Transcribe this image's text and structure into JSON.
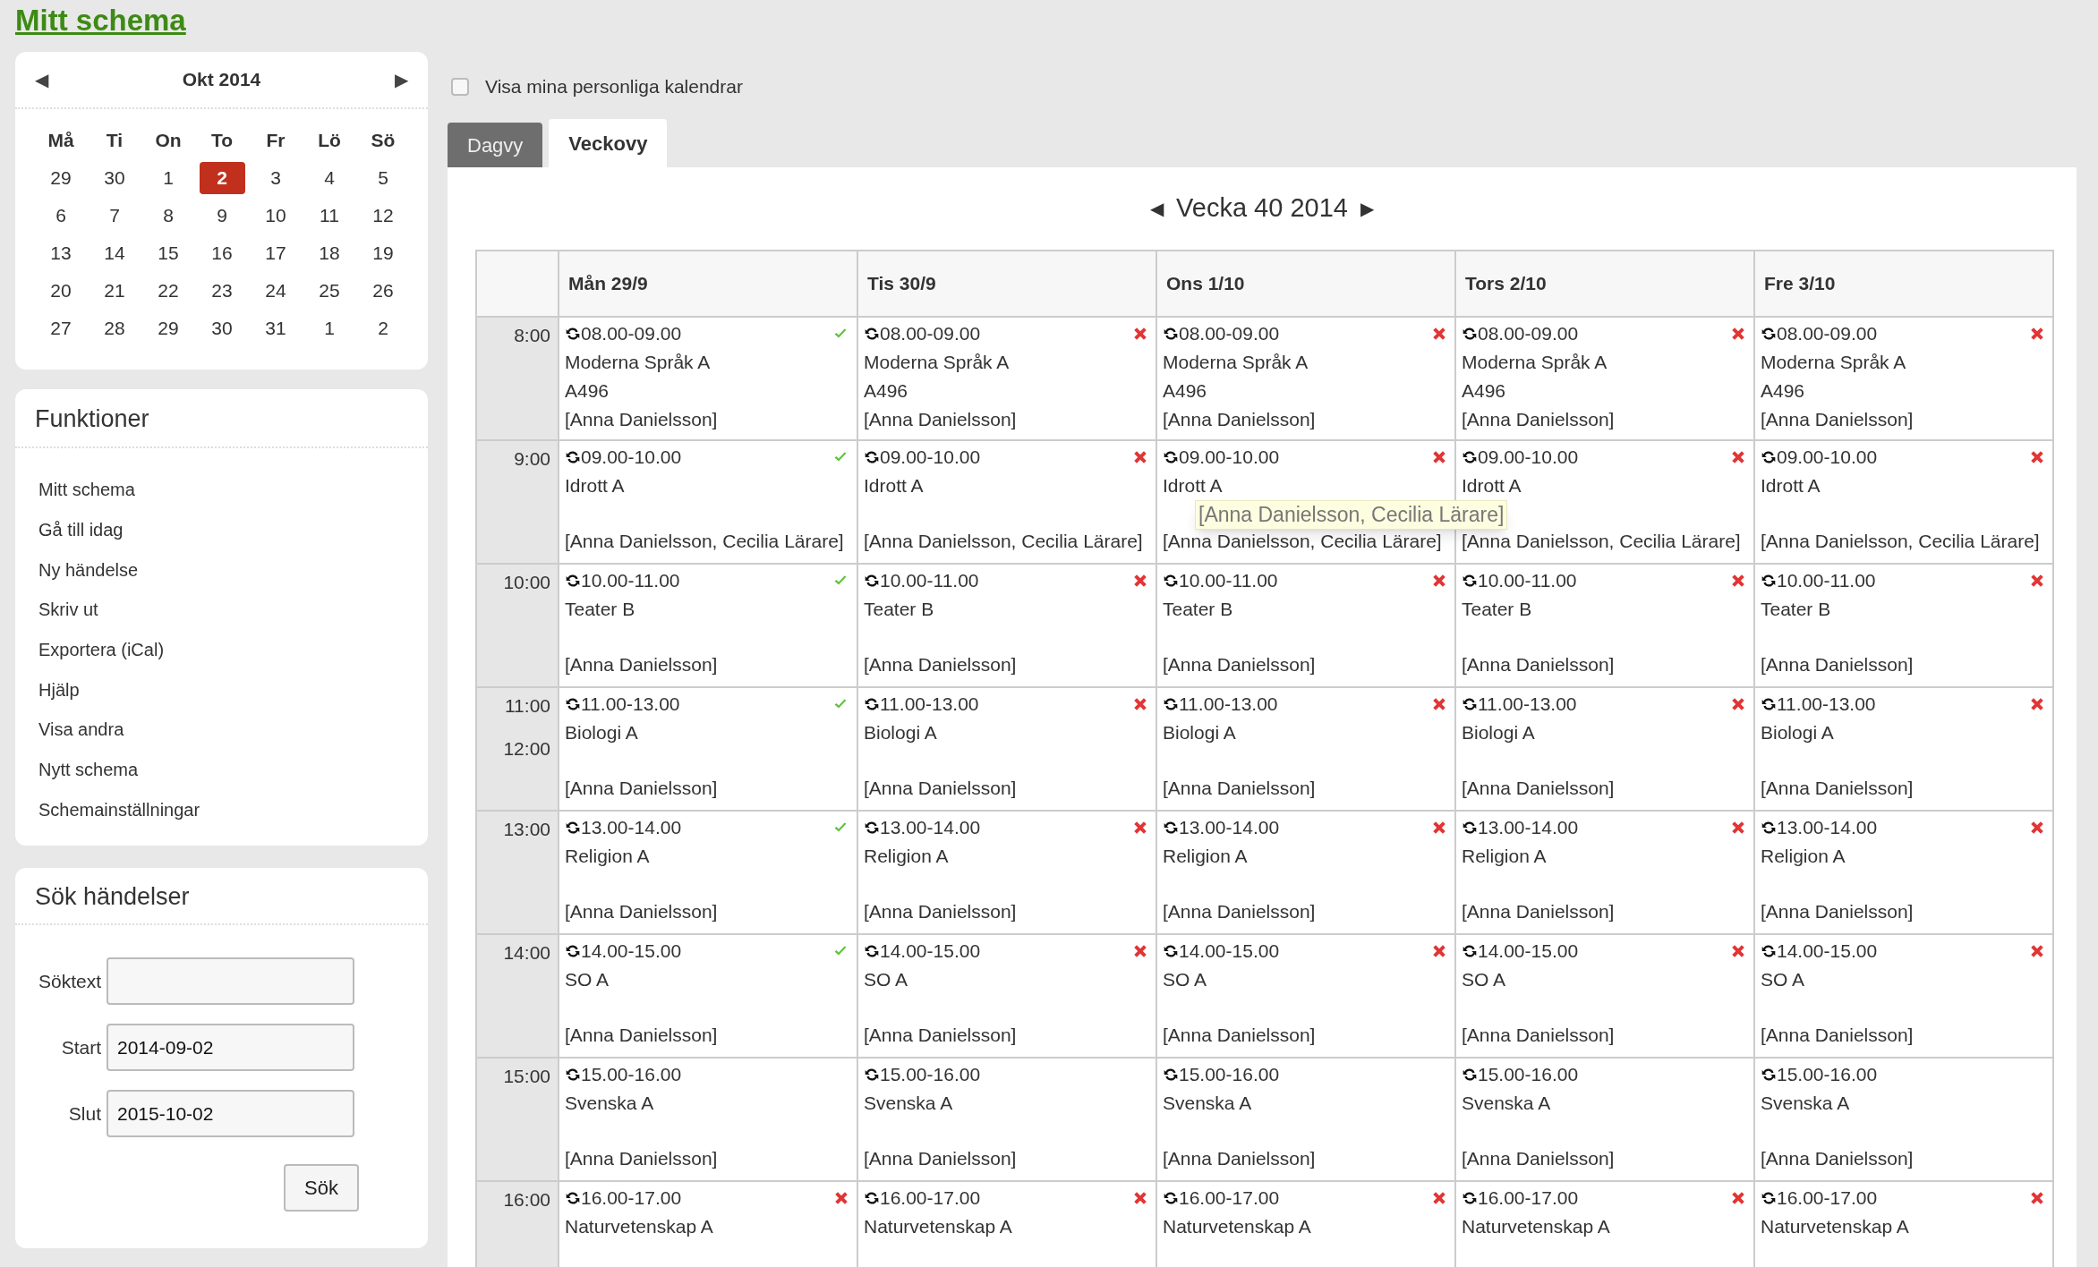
{
  "title": "Mitt schema",
  "mini_calendar": {
    "month": "Okt 2014",
    "prev": "◀",
    "next": "▶",
    "weekdays": [
      "Må",
      "Ti",
      "On",
      "To",
      "Fr",
      "Lö",
      "Sö"
    ],
    "weeks": [
      [
        {
          "day": "29",
          "selected": false
        },
        {
          "day": "30",
          "selected": false
        },
        {
          "day": "1",
          "selected": false
        },
        {
          "day": "2",
          "selected": true
        },
        {
          "day": "3",
          "selected": false
        },
        {
          "day": "4",
          "selected": false
        },
        {
          "day": "5",
          "selected": false
        }
      ],
      [
        {
          "day": "6",
          "selected": false
        },
        {
          "day": "7",
          "selected": false
        },
        {
          "day": "8",
          "selected": false
        },
        {
          "day": "9",
          "selected": false
        },
        {
          "day": "10",
          "selected": false
        },
        {
          "day": "11",
          "selected": false
        },
        {
          "day": "12",
          "selected": false
        }
      ],
      [
        {
          "day": "13",
          "selected": false
        },
        {
          "day": "14",
          "selected": false
        },
        {
          "day": "15",
          "selected": false
        },
        {
          "day": "16",
          "selected": false
        },
        {
          "day": "17",
          "selected": false
        },
        {
          "day": "18",
          "selected": false
        },
        {
          "day": "19",
          "selected": false
        }
      ],
      [
        {
          "day": "20",
          "selected": false
        },
        {
          "day": "21",
          "selected": false
        },
        {
          "day": "22",
          "selected": false
        },
        {
          "day": "23",
          "selected": false
        },
        {
          "day": "24",
          "selected": false
        },
        {
          "day": "25",
          "selected": false
        },
        {
          "day": "26",
          "selected": false
        }
      ],
      [
        {
          "day": "27",
          "selected": false
        },
        {
          "day": "28",
          "selected": false
        },
        {
          "day": "29",
          "selected": false
        },
        {
          "day": "30",
          "selected": false
        },
        {
          "day": "31",
          "selected": false
        },
        {
          "day": "1",
          "selected": false
        },
        {
          "day": "2",
          "selected": false
        }
      ]
    ]
  },
  "functions": {
    "title": "Funktioner",
    "items": [
      "Mitt schema",
      "Gå till idag",
      "Ny händelse",
      "Skriv ut",
      "Exportera (iCal)",
      "Hjälp",
      "Visa andra",
      "Nytt schema",
      "Schemainställningar"
    ]
  },
  "search": {
    "title": "Sök händelser",
    "fields": [
      {
        "label": "Söktext"
      },
      {
        "label": "Start",
        "value": "2014-09-02"
      },
      {
        "label": "Slut",
        "value": "2015-10-02"
      }
    ],
    "button": "Sök"
  },
  "personal_calendars": {
    "label": "Visa mina personliga kalendrar",
    "checked": false
  },
  "tabs": [
    {
      "label": "Dagvy",
      "selected": false
    },
    {
      "label": "Veckovy",
      "selected": true
    }
  ],
  "week": {
    "prev": "◀",
    "title": "Vecka 40 2014",
    "next": "▶"
  },
  "days": [
    "Mån 29/9",
    "Tis 30/9",
    "Ons 1/10",
    "Tors 2/10",
    "Fre 3/10"
  ],
  "rows": [
    {
      "times": [
        "8:00"
      ],
      "events": [
        {
          "time": "08.00-09.00",
          "course": "Moderna Språk A",
          "room": "A496",
          "teachers": "[Anna Danielsson]",
          "confirmed": true
        },
        {
          "time": "08.00-09.00",
          "course": "Moderna Språk A",
          "room": "A496",
          "teachers": "[Anna Danielsson]",
          "confirmed": false
        },
        {
          "time": "08.00-09.00",
          "course": "Moderna Språk A",
          "room": "A496",
          "teachers": "[Anna Danielsson]",
          "confirmed": false
        },
        {
          "time": "08.00-09.00",
          "course": "Moderna Språk A",
          "room": "A496",
          "teachers": "[Anna Danielsson]",
          "confirmed": false
        },
        {
          "time": "08.00-09.00",
          "course": "Moderna Språk A",
          "room": "A496",
          "teachers": "[Anna Danielsson]",
          "confirmed": false
        }
      ]
    },
    {
      "times": [
        "9:00"
      ],
      "events": [
        {
          "time": "09.00-10.00",
          "course": "Idrott A",
          "teachers": "[Anna Danielsson, Cecilia Lärare]",
          "confirmed": true
        },
        {
          "time": "09.00-10.00",
          "course": "Idrott A",
          "teachers": "[Anna Danielsson, Cecilia Lärare]",
          "confirmed": false
        },
        {
          "time": "09.00-10.00",
          "course": "Idrott A",
          "teachers": "[Anna Danielsson, Cecilia Lärare]",
          "confirmed": false
        },
        {
          "time": "09.00-10.00",
          "course": "Idrott A",
          "teachers": "[Anna Danielsson, Cecilia Lärare]",
          "confirmed": false
        },
        {
          "time": "09.00-10.00",
          "course": "Idrott A",
          "teachers": "[Anna Danielsson, Cecilia Lärare]",
          "confirmed": false
        }
      ]
    },
    {
      "times": [
        "10:00"
      ],
      "events": [
        {
          "time": "10.00-11.00",
          "course": "Teater B",
          "teachers": "[Anna Danielsson]",
          "confirmed": true
        },
        {
          "time": "10.00-11.00",
          "course": "Teater B",
          "teachers": "[Anna Danielsson]",
          "confirmed": false
        },
        {
          "time": "10.00-11.00",
          "course": "Teater B",
          "teachers": "[Anna Danielsson]",
          "confirmed": false
        },
        {
          "time": "10.00-11.00",
          "course": "Teater B",
          "teachers": "[Anna Danielsson]",
          "confirmed": false
        },
        {
          "time": "10.00-11.00",
          "course": "Teater B",
          "teachers": "[Anna Danielsson]",
          "confirmed": false
        }
      ]
    },
    {
      "times": [
        "11:00",
        "12:00"
      ],
      "events": [
        {
          "time": "11.00-13.00",
          "course": "Biologi A",
          "teachers": "[Anna Danielsson]",
          "confirmed": true
        },
        {
          "time": "11.00-13.00",
          "course": "Biologi A",
          "teachers": "[Anna Danielsson]",
          "confirmed": false
        },
        {
          "time": "11.00-13.00",
          "course": "Biologi A",
          "teachers": "[Anna Danielsson]",
          "confirmed": false
        },
        {
          "time": "11.00-13.00",
          "course": "Biologi A",
          "teachers": "[Anna Danielsson]",
          "confirmed": false
        },
        {
          "time": "11.00-13.00",
          "course": "Biologi A",
          "teachers": "[Anna Danielsson]",
          "confirmed": false
        }
      ]
    },
    {
      "times": [
        "13:00"
      ],
      "events": [
        {
          "time": "13.00-14.00",
          "course": "Religion A",
          "teachers": "[Anna Danielsson]",
          "confirmed": true
        },
        {
          "time": "13.00-14.00",
          "course": "Religion A",
          "teachers": "[Anna Danielsson]",
          "confirmed": false
        },
        {
          "time": "13.00-14.00",
          "course": "Religion A",
          "teachers": "[Anna Danielsson]",
          "confirmed": false
        },
        {
          "time": "13.00-14.00",
          "course": "Religion A",
          "teachers": "[Anna Danielsson]",
          "confirmed": false
        },
        {
          "time": "13.00-14.00",
          "course": "Religion A",
          "teachers": "[Anna Danielsson]",
          "confirmed": false
        }
      ]
    },
    {
      "times": [
        "14:00"
      ],
      "events": [
        {
          "time": "14.00-15.00",
          "course": "SO A",
          "teachers": "[Anna Danielsson]",
          "confirmed": true
        },
        {
          "time": "14.00-15.00",
          "course": "SO A",
          "teachers": "[Anna Danielsson]",
          "confirmed": false
        },
        {
          "time": "14.00-15.00",
          "course": "SO A",
          "teachers": "[Anna Danielsson]",
          "confirmed": false
        },
        {
          "time": "14.00-15.00",
          "course": "SO A",
          "teachers": "[Anna Danielsson]",
          "confirmed": false
        },
        {
          "time": "14.00-15.00",
          "course": "SO A",
          "teachers": "[Anna Danielsson]",
          "confirmed": false
        }
      ]
    },
    {
      "times": [
        "15:00"
      ],
      "events": [
        {
          "time": "15.00-16.00",
          "course": "Svenska A",
          "teachers": "[Anna Danielsson]"
        },
        {
          "time": "15.00-16.00",
          "course": "Svenska A",
          "teachers": "[Anna Danielsson]"
        },
        {
          "time": "15.00-16.00",
          "course": "Svenska A",
          "teachers": "[Anna Danielsson]"
        },
        {
          "time": "15.00-16.00",
          "course": "Svenska A",
          "teachers": "[Anna Danielsson]"
        },
        {
          "time": "15.00-16.00",
          "course": "Svenska A",
          "teachers": "[Anna Danielsson]"
        }
      ]
    },
    {
      "times": [
        "16:00"
      ],
      "events": [
        {
          "time": "16.00-17.00",
          "course": "Naturvetenskap A",
          "confirmed": false
        },
        {
          "time": "16.00-17.00",
          "course": "Naturvetenskap A",
          "confirmed": false
        },
        {
          "time": "16.00-17.00",
          "course": "Naturvetenskap A",
          "confirmed": false
        },
        {
          "time": "16.00-17.00",
          "course": "Naturvetenskap A",
          "confirmed": false
        },
        {
          "time": "16.00-17.00",
          "course": "Naturvetenskap A",
          "confirmed": false
        }
      ]
    }
  ],
  "tooltip": "[Anna Danielsson, Cecilia Lärare]"
}
